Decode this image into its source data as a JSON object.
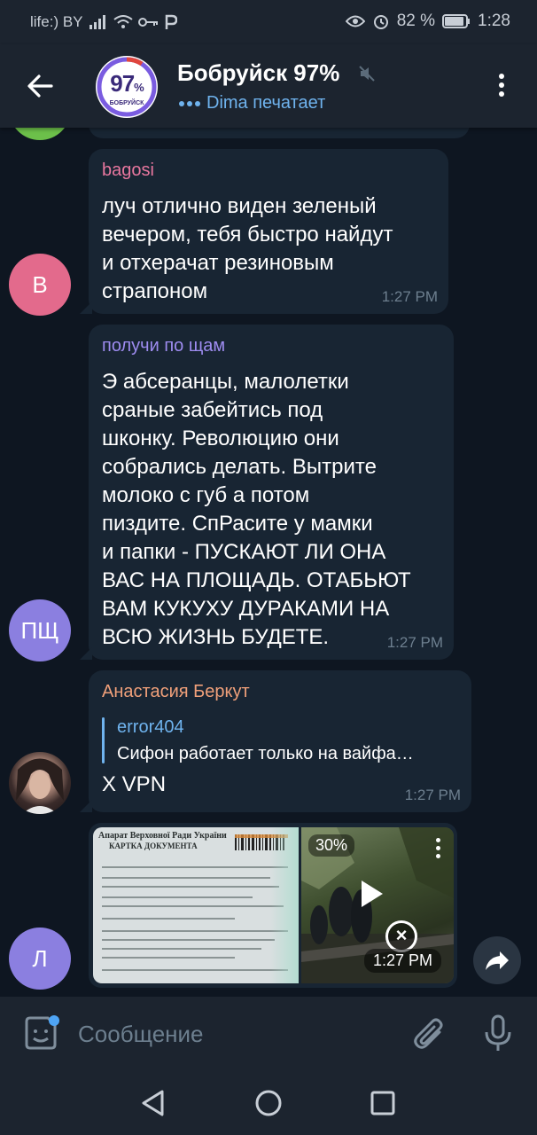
{
  "status_bar": {
    "carrier": "life:) BY",
    "battery": "82 %",
    "time": "1:28"
  },
  "header": {
    "logo_text": "97",
    "logo_small": "%",
    "logo_sub": "БОБРУЙСК",
    "title": "Бобруйск 97%",
    "typing": "Dima печатает"
  },
  "messages": [
    {
      "sender": "bagosi",
      "sender_color": "#e8779f",
      "avatar_letter": "B",
      "avatar_color": "#e36a8c",
      "text": "луч отлично виден зеленый\nвечером, тебя быстро найдут\nи отхерачат резиновым\nстрапоном",
      "time": "1:27 PM"
    },
    {
      "sender": "получи по щам",
      "sender_color": "#9e8cf0",
      "avatar_letter": "ПЩ",
      "avatar_color": "#8b7fe0",
      "text": "Э абсеранцы, малолетки\nсраные забейтись под\nшконку. Революцию они\nсобрались делать. Вытрите\nмолоко с губ а потом\nпиздите. СпРасите у мамки\nи папки - ПУСКАЮТ ЛИ ОНА\nВАС НА ПЛОЩАДЬ. ОТАБЬЮТ\nВАМ КУКУХУ ДУРАКАМИ НА\nВСЮ ЖИЗНЬ БУДЕТЕ.",
      "time": "1:27 PM"
    },
    {
      "sender": "Анастасия Беркут",
      "sender_color": "#f0a07a",
      "reply_name": "error404",
      "reply_text": "Сифон работает только на вайфа…",
      "text": "X VPN",
      "time": "1:27 PM"
    }
  ],
  "media_message": {
    "avatar_letter": "Л",
    "avatar_color": "#8b7fe0",
    "doc_header": "Апарат Верховної Ради України",
    "doc_title": "КАРТКА ДОКУМЕНТА",
    "video_progress": "30%",
    "time": "1:27 PM"
  },
  "composer": {
    "placeholder": "Сообщение"
  }
}
